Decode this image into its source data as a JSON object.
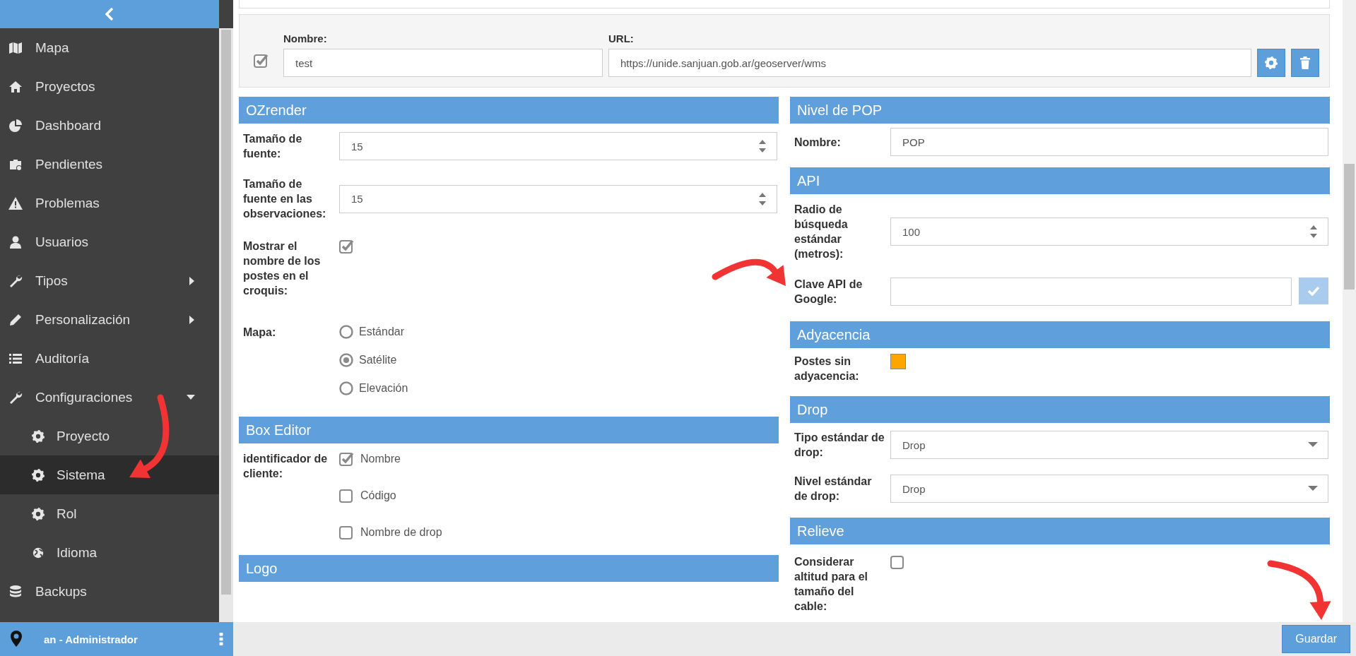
{
  "sidebar": {
    "items": [
      {
        "label": "Mapa",
        "selected": false
      },
      {
        "label": "Proyectos",
        "selected": false
      },
      {
        "label": "Dashboard",
        "selected": false
      },
      {
        "label": "Pendientes",
        "selected": false
      },
      {
        "label": "Problemas",
        "selected": false
      },
      {
        "label": "Usuarios",
        "selected": false
      },
      {
        "label": "Tipos",
        "selected": false,
        "expanded": false
      },
      {
        "label": "Personalización",
        "selected": false,
        "expanded": false
      },
      {
        "label": "Auditoría",
        "selected": false
      },
      {
        "label": "Configuraciones",
        "selected": false,
        "expanded": true,
        "children": [
          {
            "label": "Proyecto",
            "selected": false
          },
          {
            "label": "Sistema",
            "selected": true
          },
          {
            "label": "Rol",
            "selected": false
          },
          {
            "label": "Idioma",
            "selected": false
          }
        ]
      },
      {
        "label": "Backups",
        "selected": false
      }
    ],
    "footer": {
      "user": "an - Administrador"
    }
  },
  "server": {
    "checked": true,
    "name_label": "Nombre:",
    "name": "test",
    "url_label": "URL:",
    "url": "https://unide.sanjuan.gob.ar/geoserver/wms"
  },
  "left_sections": [
    {
      "title": "OZrender",
      "fields": [
        {
          "kind": "number",
          "label": "Tamaño de fuente:",
          "value": "15"
        },
        {
          "kind": "number",
          "label": "Tamaño de fuente en las observaciones:",
          "value": "15"
        },
        {
          "kind": "checkbox",
          "label": "Mostrar el nombre de los postes en el croquis:",
          "checked": true
        },
        {
          "kind": "radio",
          "label": "Mapa:",
          "options": [
            {
              "label": "Estándar",
              "selected": false
            },
            {
              "label": "Satélite",
              "selected": true
            },
            {
              "label": "Elevación",
              "selected": false
            }
          ]
        }
      ]
    },
    {
      "title": "Box Editor",
      "fields": [
        {
          "kind": "checklist",
          "label": "identificador de cliente:",
          "options": [
            {
              "label": "Nombre",
              "checked": true
            },
            {
              "label": "Código",
              "checked": false
            },
            {
              "label": "Nombre de drop",
              "checked": false
            }
          ]
        }
      ]
    },
    {
      "title": "Logo"
    }
  ],
  "right_sections": [
    {
      "title": "Nivel de POP",
      "fields": [
        {
          "kind": "text",
          "label": "Nombre:",
          "value": "POP"
        }
      ]
    },
    {
      "title": "API",
      "fields": [
        {
          "kind": "number",
          "label": "Radio de búsqueda estándar (metros):",
          "value": "100"
        },
        {
          "kind": "confirm",
          "label": "Clave API de Google:",
          "confirm_button": {
            "disabled": true
          }
        }
      ]
    },
    {
      "title": "Adyacencia",
      "fields": [
        {
          "kind": "color",
          "label": "Postes sin adyacencia:",
          "color": "#ffa500"
        }
      ]
    },
    {
      "title": "Drop",
      "fields": [
        {
          "kind": "select",
          "label": "Tipo estándar de drop:",
          "value": "Drop"
        },
        {
          "kind": "select",
          "label": "Nivel estándar de drop:",
          "value": "Drop"
        }
      ]
    },
    {
      "title": "Relieve",
      "fields": [
        {
          "kind": "checkbox",
          "label": "Considerar altitud para el tamaño del cable:",
          "checked": false
        }
      ]
    }
  ],
  "save_button": "Guardar",
  "annotations": [
    {
      "kind": "arrow"
    },
    {
      "kind": "arrow"
    },
    {
      "kind": "arrow"
    }
  ]
}
